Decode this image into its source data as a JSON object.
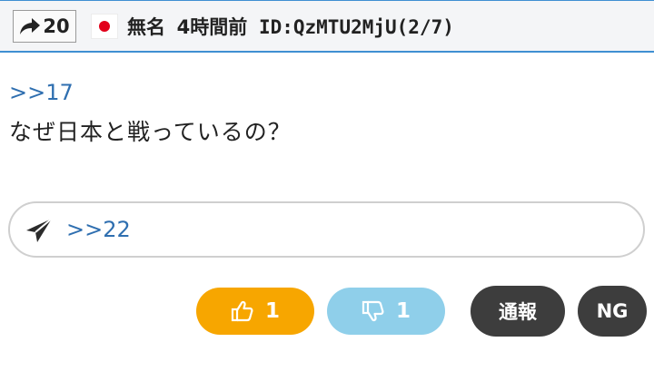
{
  "header": {
    "reply_count": "20",
    "reply_icon": "share-arrow-icon",
    "flag": "japan-flag-icon",
    "name": "無名",
    "time": "4時間前",
    "id": "ID:QzMTU2MjU(2/7)"
  },
  "post": {
    "anchor": ">>17",
    "body": "なぜ日本と戦っているの？"
  },
  "reply_bar": {
    "icon": "send-icon",
    "anchor": ">>22"
  },
  "actions": {
    "good_count": "1",
    "bad_count": "1",
    "report_label": "通報",
    "ng_label": "NG"
  },
  "colors": {
    "header_border": "#3f8fd2",
    "link": "#2f6fb0",
    "good": "#f7a600",
    "bad": "#8fcfea",
    "dark_button": "#3d3d3d"
  }
}
